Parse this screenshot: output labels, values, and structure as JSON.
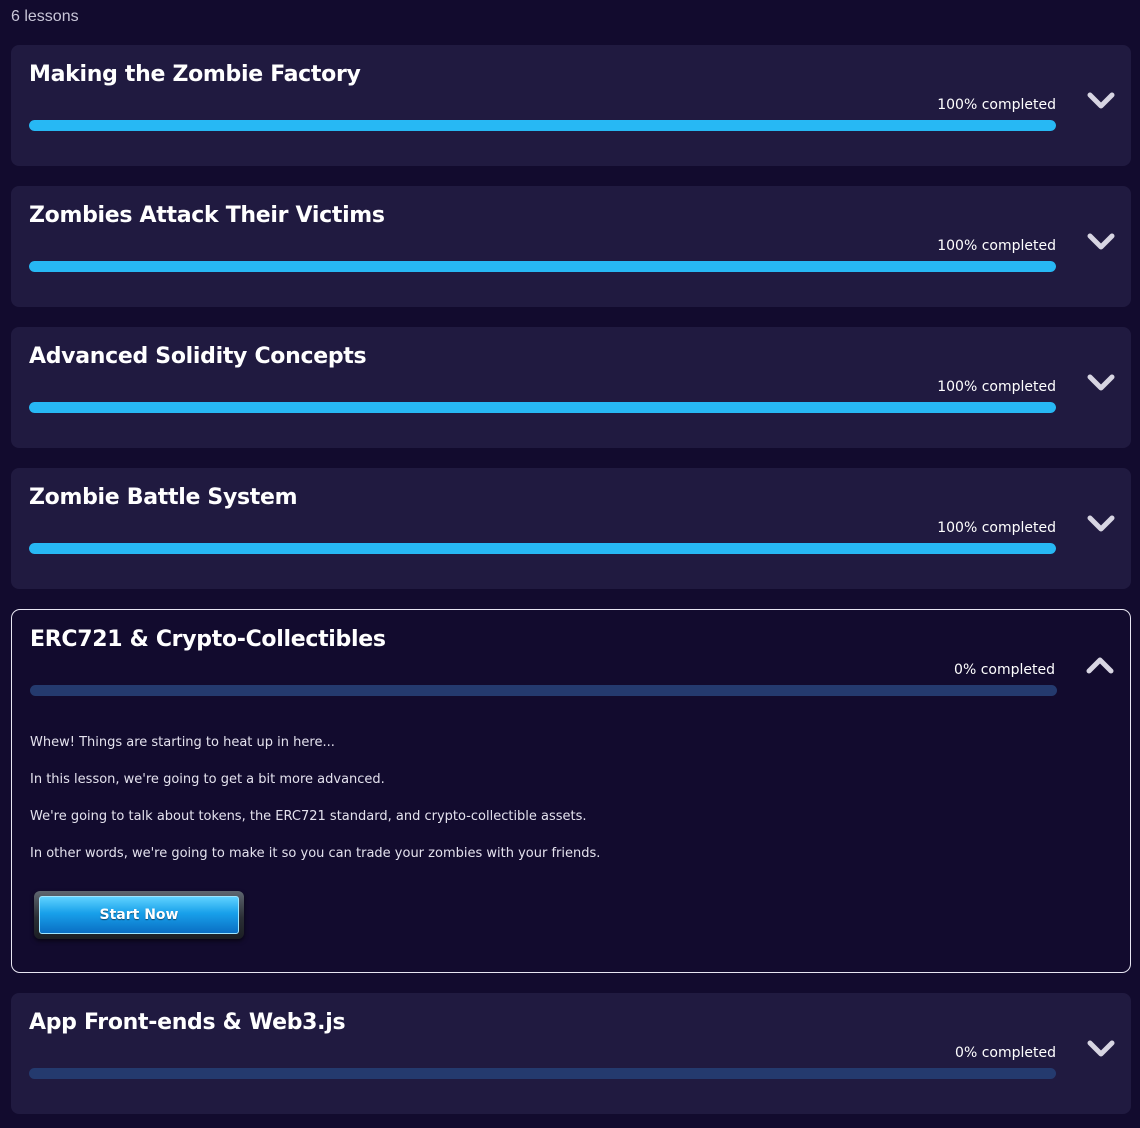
{
  "header": {
    "lessons_count": "6 lessons"
  },
  "colors": {
    "progress_fill": "#27b8f4",
    "progress_track": "#243a6e",
    "card_bg": "#201a40",
    "page_bg": "#120b2e"
  },
  "lessons": [
    {
      "title": "Making the Zombie Factory",
      "status": "100% completed",
      "progress": 1.0,
      "expanded": false,
      "toggle_icon": "chevron-down-icon"
    },
    {
      "title": "Zombies Attack Their Victims",
      "status": "100% completed",
      "progress": 1.0,
      "expanded": false,
      "toggle_icon": "chevron-down-icon"
    },
    {
      "title": "Advanced Solidity Concepts",
      "status": "100% completed",
      "progress": 1.0,
      "expanded": false,
      "toggle_icon": "chevron-down-icon"
    },
    {
      "title": "Zombie Battle System",
      "status": "100% completed",
      "progress": 1.0,
      "expanded": false,
      "toggle_icon": "chevron-down-icon"
    },
    {
      "title": "ERC721 & Crypto-Collectibles",
      "status": "0% completed",
      "progress": 0.0,
      "expanded": true,
      "toggle_icon": "chevron-up-icon",
      "description": [
        "Whew! Things are starting to heat up in here...",
        "In this lesson, we're going to get a bit more advanced.",
        "We're going to talk about tokens, the ERC721 standard, and crypto-collectible assets.",
        "In other words, we're going to make it so you can trade your zombies with your friends."
      ],
      "button_label": "Start Now"
    },
    {
      "title": "App Front-ends & Web3.js",
      "status": "0% completed",
      "progress": 0.0,
      "expanded": false,
      "toggle_icon": "chevron-down-icon"
    }
  ]
}
